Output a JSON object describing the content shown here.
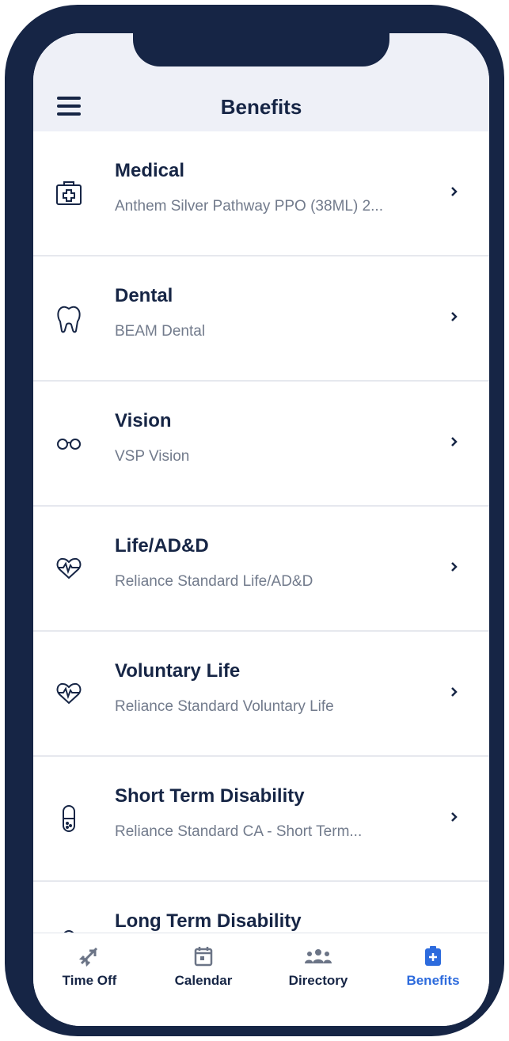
{
  "header": {
    "title": "Benefits"
  },
  "benefits": [
    {
      "name": "Medical",
      "provider": "Anthem Silver Pathway PPO (38ML) 2...",
      "icon": "medical-kit-icon"
    },
    {
      "name": "Dental",
      "provider": "BEAM Dental",
      "icon": "tooth-icon"
    },
    {
      "name": "Vision",
      "provider": "VSP Vision",
      "icon": "glasses-icon"
    },
    {
      "name": "Life/AD&D",
      "provider": "Reliance Standard Life/AD&D",
      "icon": "heart-pulse-icon"
    },
    {
      "name": "Voluntary Life",
      "provider": "Reliance Standard Voluntary Life",
      "icon": "heart-pulse-icon"
    },
    {
      "name": "Short Term Disability",
      "provider": "Reliance Standard CA - Short Term...",
      "icon": "pill-icon"
    },
    {
      "name": "Long Term Disability",
      "provider": "",
      "icon": "pill-icon"
    }
  ],
  "tabs": [
    {
      "label": "Time Off",
      "icon": "airplane-icon"
    },
    {
      "label": "Calendar",
      "icon": "calendar-icon"
    },
    {
      "label": "Directory",
      "icon": "people-icon"
    },
    {
      "label": "Benefits",
      "icon": "clipboard-medical-icon"
    }
  ],
  "colors": {
    "navy": "#162545",
    "accent": "#2d6bdd",
    "muted": "#727b8c",
    "header_bg": "#eef0f7"
  }
}
